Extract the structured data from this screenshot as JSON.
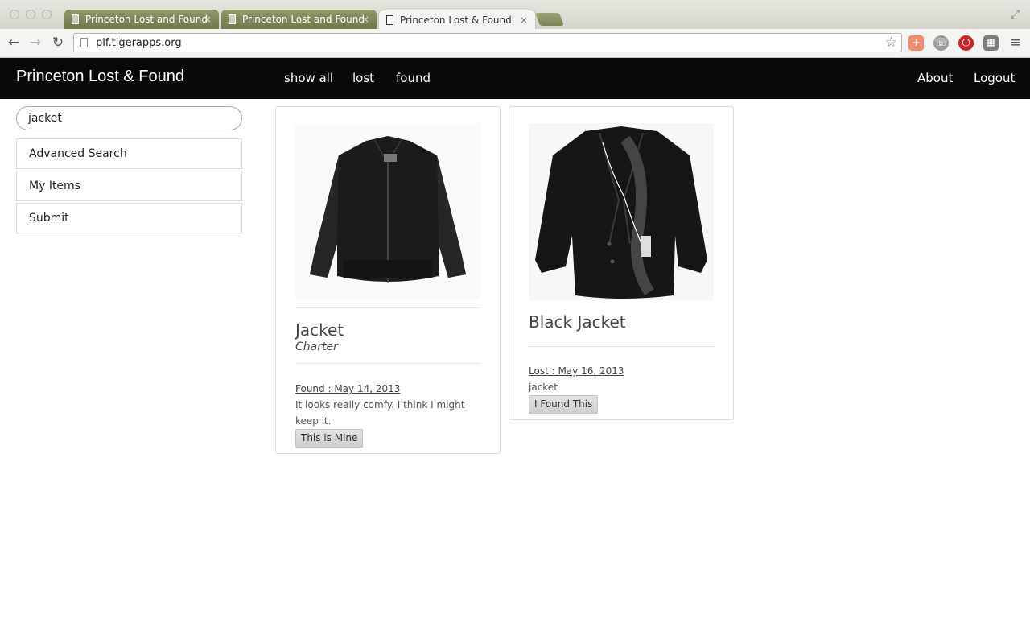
{
  "browser": {
    "tabs": [
      {
        "label": "Princeton Lost and Found",
        "active": false
      },
      {
        "label": "Princeton Lost and Found",
        "active": false
      },
      {
        "label": "Princeton Lost & Found",
        "active": true
      }
    ],
    "url": "plf.tigerapps.org",
    "close_glyph": "×",
    "back_glyph": "←",
    "forward_glyph": "→",
    "reload_glyph": "↻",
    "star_glyph": "☆",
    "menu_glyph": "≡",
    "fullscreen_glyph": "⤢"
  },
  "site": {
    "brand": "Princeton Lost & Found",
    "nav": [
      "show all",
      "lost",
      "found"
    ],
    "right_nav": [
      "About",
      "Logout"
    ]
  },
  "sidebar": {
    "search_value": "jacket",
    "items": [
      "Advanced Search",
      "My Items",
      "Submit"
    ]
  },
  "items": [
    {
      "title": "Jacket",
      "subtitle": "Charter",
      "status": "Found : May 14, 2013",
      "description": "It looks really comfy. I think I might keep it.",
      "button": "This is Mine"
    },
    {
      "title": "Black Jacket",
      "status": "Lost : May 16, 2013",
      "description": "jacket",
      "button": "I Found This"
    }
  ],
  "colors": {
    "navbar": "#080808",
    "tab_inactive": "#7a8452",
    "border": "#dddddd"
  }
}
